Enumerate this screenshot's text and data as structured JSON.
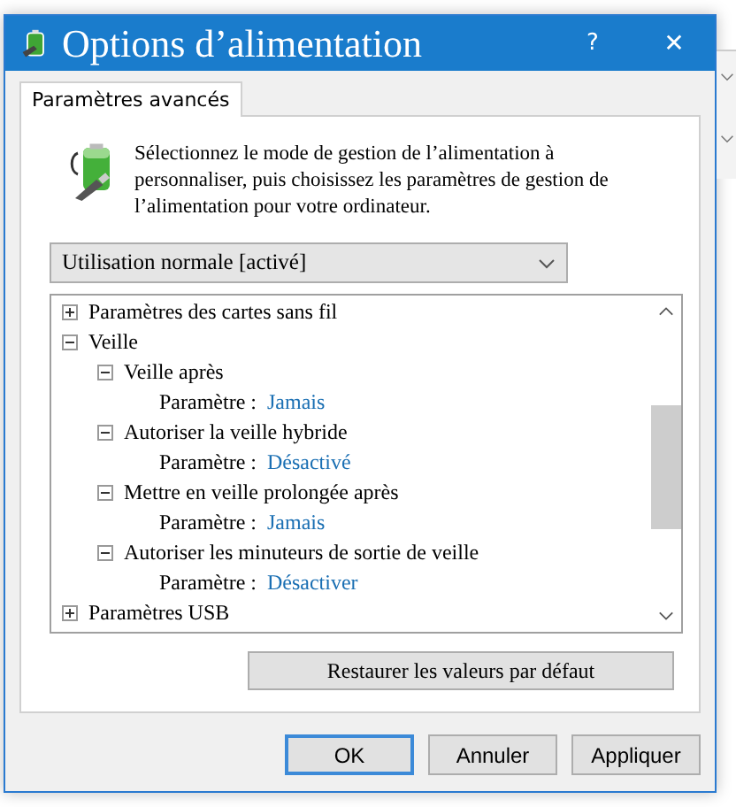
{
  "window": {
    "title": "Options d’alimentation",
    "help": "?",
    "close": "✕"
  },
  "tabs": [
    {
      "label": "Paramètres avancés",
      "selected": true
    }
  ],
  "description": "Sélectionnez le mode de gestion de l’alimentation à personnaliser, puis choisissez les paramètres de gestion de l’alimentation pour votre ordinateur.",
  "plan_dropdown": {
    "value": "Utilisation normale [activé]"
  },
  "tree": [
    {
      "kind": "group",
      "label": "Paramètres des cartes sans fil",
      "expanded": false
    },
    {
      "kind": "group",
      "label": "Veille",
      "expanded": true,
      "children": [
        {
          "kind": "group",
          "label": "Veille après",
          "expanded": true,
          "children": [
            {
              "kind": "setting",
              "label": "Paramètre :",
              "value": "Jamais"
            }
          ]
        },
        {
          "kind": "group",
          "label": "Autoriser la veille hybride",
          "expanded": true,
          "children": [
            {
              "kind": "setting",
              "label": "Paramètre :",
              "value": "Désactivé"
            }
          ]
        },
        {
          "kind": "group",
          "label": "Mettre en veille prolongée après",
          "expanded": true,
          "children": [
            {
              "kind": "setting",
              "label": "Paramètre :",
              "value": "Jamais"
            }
          ]
        },
        {
          "kind": "group",
          "label": "Autoriser les minuteurs de sortie de veille",
          "expanded": true,
          "children": [
            {
              "kind": "setting",
              "label": "Paramètre :",
              "value": "Désactiver"
            }
          ]
        }
      ]
    },
    {
      "kind": "group",
      "label": "Paramètres USB",
      "expanded": false
    }
  ],
  "restore_button": "Restaurer les valeurs par défaut",
  "buttons": [
    {
      "label": "OK",
      "default": true
    },
    {
      "label": "Annuler",
      "default": false
    },
    {
      "label": "Appliquer",
      "default": false
    }
  ]
}
